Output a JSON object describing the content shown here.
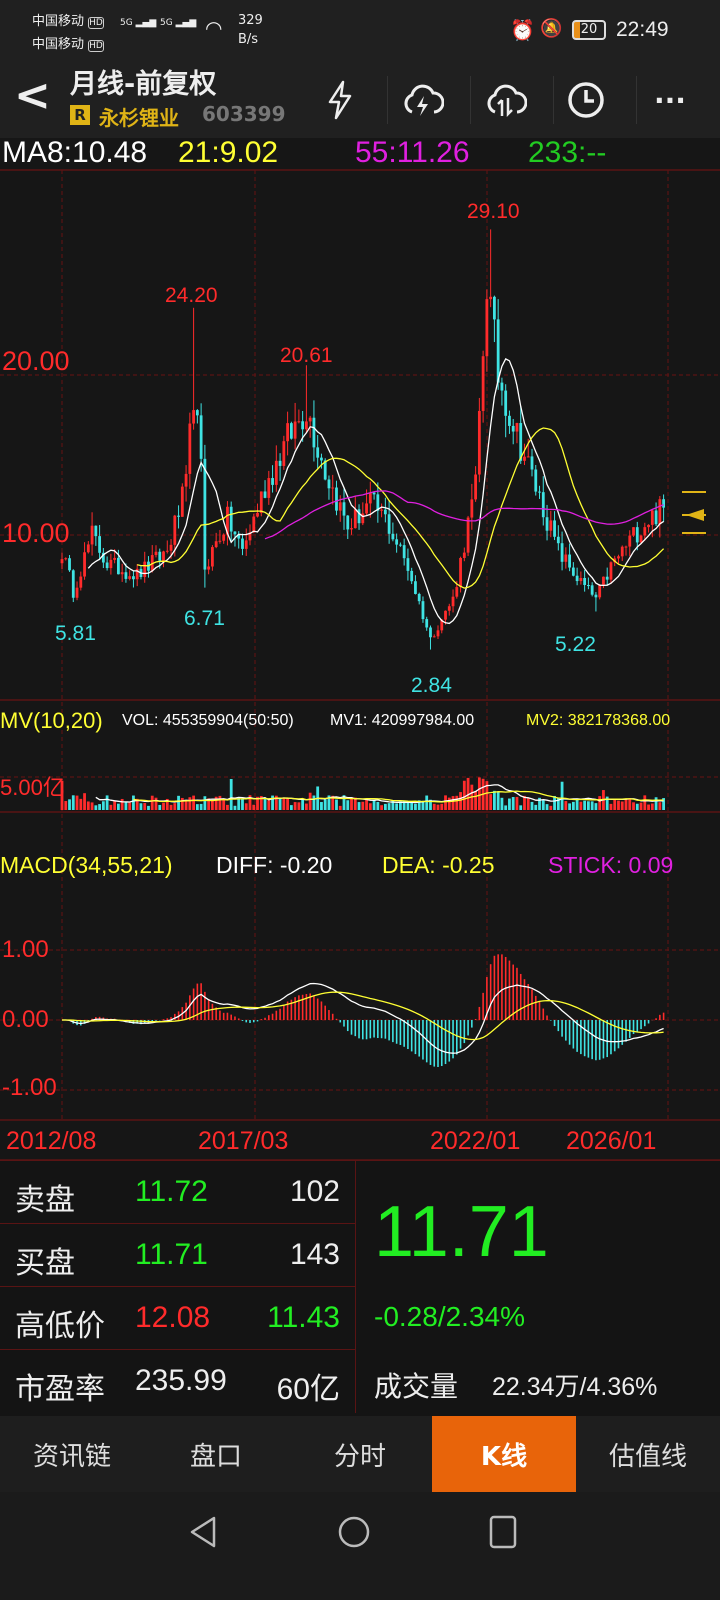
{
  "status_bar": {
    "carrier1": "中国移动",
    "carrier2": "中国移动",
    "hd": "HD",
    "net1": "5G",
    "net2": "5G",
    "speed_value": "329",
    "speed_unit": "B/s",
    "battery": "20",
    "time": "22:49"
  },
  "header": {
    "title": "月线-前复权",
    "badge": "R",
    "stock_name": "永杉锂业",
    "stock_code": "603399"
  },
  "ma_bar": {
    "ma8": "MA8:10.48",
    "ma21": "21:9.02",
    "ma55": "55:11.26",
    "ma233": "233:--"
  },
  "price_axis": {
    "label_20": "20.00",
    "label_10": "10.00"
  },
  "price_marks": {
    "high1": "24.20",
    "high2": "20.61",
    "high3": "29.10",
    "low1": "5.81",
    "low2": "6.71",
    "low3": "2.84",
    "low4": "5.22"
  },
  "volume": {
    "title": "MV(10,20)",
    "vol": "VOL: 455359904(50:50)",
    "mv1": "MV1: 420997984.00",
    "mv2": "MV2: 382178368.00",
    "axis_label": "5.00亿"
  },
  "macd": {
    "title": "MACD(34,55,21)",
    "diff": "DIFF: -0.20",
    "dea": "DEA: -0.25",
    "stick": "STICK: 0.09",
    "axis_1": "1.00",
    "axis_0": "0.00",
    "axis_m1": "-1.00"
  },
  "dates": [
    "2012/08",
    "2017/03",
    "2022/01",
    "2026/01"
  ],
  "quote": {
    "sell_label": "卖盘",
    "sell_price": "11.72",
    "sell_qty": "102",
    "buy_label": "买盘",
    "buy_price": "11.71",
    "buy_qty": "143",
    "hl_label": "高低价",
    "high": "12.08",
    "low": "11.43",
    "pe_label": "市盈率",
    "pe": "235.99",
    "mcap": "60亿",
    "last": "11.71",
    "change": "-0.28/2.34%",
    "vol_label": "成交量",
    "vol_value": "22.34万/4.36%"
  },
  "tabs": [
    "资讯链",
    "盘口",
    "分时",
    "K线",
    "估值线"
  ],
  "colors": {
    "up": "#ff2b2b",
    "down": "#3fe3e3",
    "ma8": "#ffffff",
    "ma21": "#ffff33",
    "ma55": "#e020e0",
    "accent": "#e8640a",
    "grid": "#5a1414"
  },
  "chart_data": {
    "type": "candlestick",
    "title": "月线-前复权",
    "x_start": "2012/08",
    "x_ticks": [
      "2012/08",
      "2017/03",
      "2022/01",
      "2026/01"
    ],
    "ylim": [
      2,
      31
    ],
    "close_keyframes": [
      [
        0,
        9
      ],
      [
        3,
        6.5
      ],
      [
        8,
        10
      ],
      [
        12,
        8.2
      ],
      [
        20,
        7.5
      ],
      [
        28,
        9
      ],
      [
        33,
        13
      ],
      [
        35,
        19
      ],
      [
        37,
        14
      ],
      [
        38,
        8
      ],
      [
        44,
        11
      ],
      [
        48,
        9
      ],
      [
        54,
        13
      ],
      [
        60,
        16
      ],
      [
        65,
        18
      ],
      [
        70,
        14
      ],
      [
        76,
        10.5
      ],
      [
        82,
        12
      ],
      [
        86,
        11
      ],
      [
        92,
        8
      ],
      [
        98,
        3.5
      ],
      [
        104,
        6
      ],
      [
        110,
        13
      ],
      [
        113,
        26
      ],
      [
        116,
        20
      ],
      [
        120,
        17
      ],
      [
        126,
        13
      ],
      [
        132,
        9
      ],
      [
        138,
        7
      ],
      [
        142,
        6
      ],
      [
        146,
        8
      ],
      [
        152,
        10
      ],
      [
        156,
        11
      ],
      [
        160,
        11.71
      ]
    ],
    "marked_highs": [
      [
        35,
        24.2
      ],
      [
        65,
        20.61
      ],
      [
        114,
        29.1
      ]
    ],
    "marked_lows": [
      [
        3,
        5.81
      ],
      [
        38,
        6.71
      ],
      [
        98,
        2.84
      ],
      [
        142,
        5.22
      ]
    ],
    "ma_periods": [
      8,
      21,
      55
    ],
    "volume_ma": [
      10,
      20
    ],
    "macd_params": [
      34,
      55,
      21
    ]
  }
}
